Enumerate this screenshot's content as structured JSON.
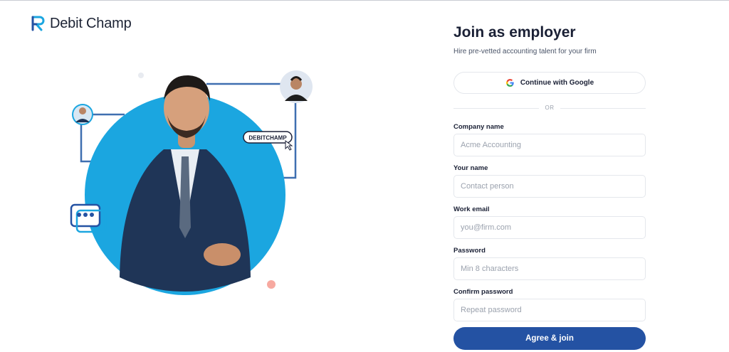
{
  "brand": {
    "name": "Debit Champ"
  },
  "hero": {
    "badge": "DEBITCHAMP"
  },
  "form": {
    "title": "Join as employer",
    "subtitle": "Hire pre-vetted accounting talent for your firm",
    "google_button": "Continue with Google",
    "divider": "OR",
    "fields": [
      {
        "label": "Company name",
        "placeholder": "Acme Accounting",
        "value": ""
      },
      {
        "label": "Your name",
        "placeholder": "Contact person",
        "value": ""
      },
      {
        "label": "Work email",
        "placeholder": "you@firm.com",
        "value": ""
      },
      {
        "label": "Password",
        "placeholder": "Min 8 characters",
        "value": ""
      },
      {
        "label": "Confirm password",
        "placeholder": "Repeat password",
        "value": ""
      }
    ],
    "submit": "Agree & join"
  },
  "colors": {
    "primary": "#2452a3",
    "accent": "#1ba6e0",
    "connector": "#3f6fb0",
    "text": "#1a2035"
  },
  "icons": [
    "logo-icon",
    "google-icon",
    "chat-bubble-icon",
    "cursor-hand-icon"
  ]
}
